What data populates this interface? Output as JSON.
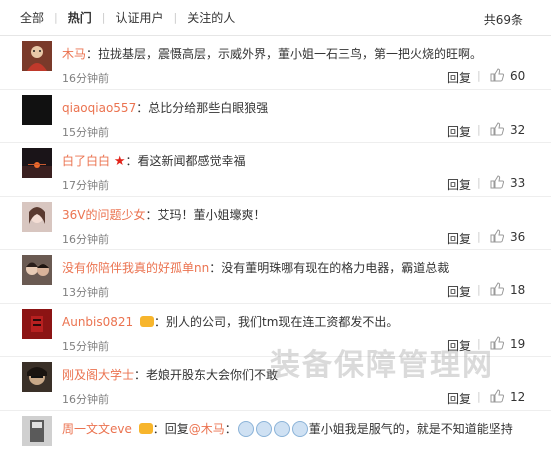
{
  "filter": {
    "tabs": [
      "全部",
      "热门",
      "认证用户",
      "关注的人"
    ],
    "total": "共69条"
  },
  "reply_label": "回复",
  "comments": [
    {
      "name": "木马",
      "sep": "：",
      "text": "拉拢基层，震慑高层，示威外界，董小姐一石三鸟，第一把火烧的旺啊。",
      "time": "16分钟前",
      "likes": "60"
    },
    {
      "name": "qiaoqiao557",
      "sep": "：",
      "text": "总比分给那些白眼狼强",
      "time": "15分钟前",
      "likes": "32"
    },
    {
      "name": "白了白白",
      "sep": "：",
      "text": "看这新闻都感觉幸福",
      "time": "17分钟前",
      "likes": "33"
    },
    {
      "name": "36V的问题少女",
      "sep": "：",
      "text": "艾玛！董小姐壕爽！",
      "time": "16分钟前",
      "likes": "36"
    },
    {
      "name": "没有你陪伴我真的好孤单nn",
      "sep": "：",
      "text": "没有董明珠哪有现在的格力电器，霸道总裁",
      "time": "13分钟前",
      "likes": "18"
    },
    {
      "name": "Aunbis0821",
      "sep": "：",
      "text": "别人的公司，我们tm现在连工资都发不出。",
      "time": "15分钟前",
      "likes": "19"
    },
    {
      "name": "刚及阁大学士",
      "sep": "：",
      "text": "老娘开股东大会你们不敢",
      "time": "16分钟前",
      "likes": "12"
    },
    {
      "name": "周一文文eve",
      "sep": "：",
      "prefix": "回复",
      "mention": "@木马",
      "text": "董小姐我是服气的，就是不知道能坚持",
      "time": "",
      "likes": ""
    }
  ],
  "watermark": "装备保障管理网"
}
